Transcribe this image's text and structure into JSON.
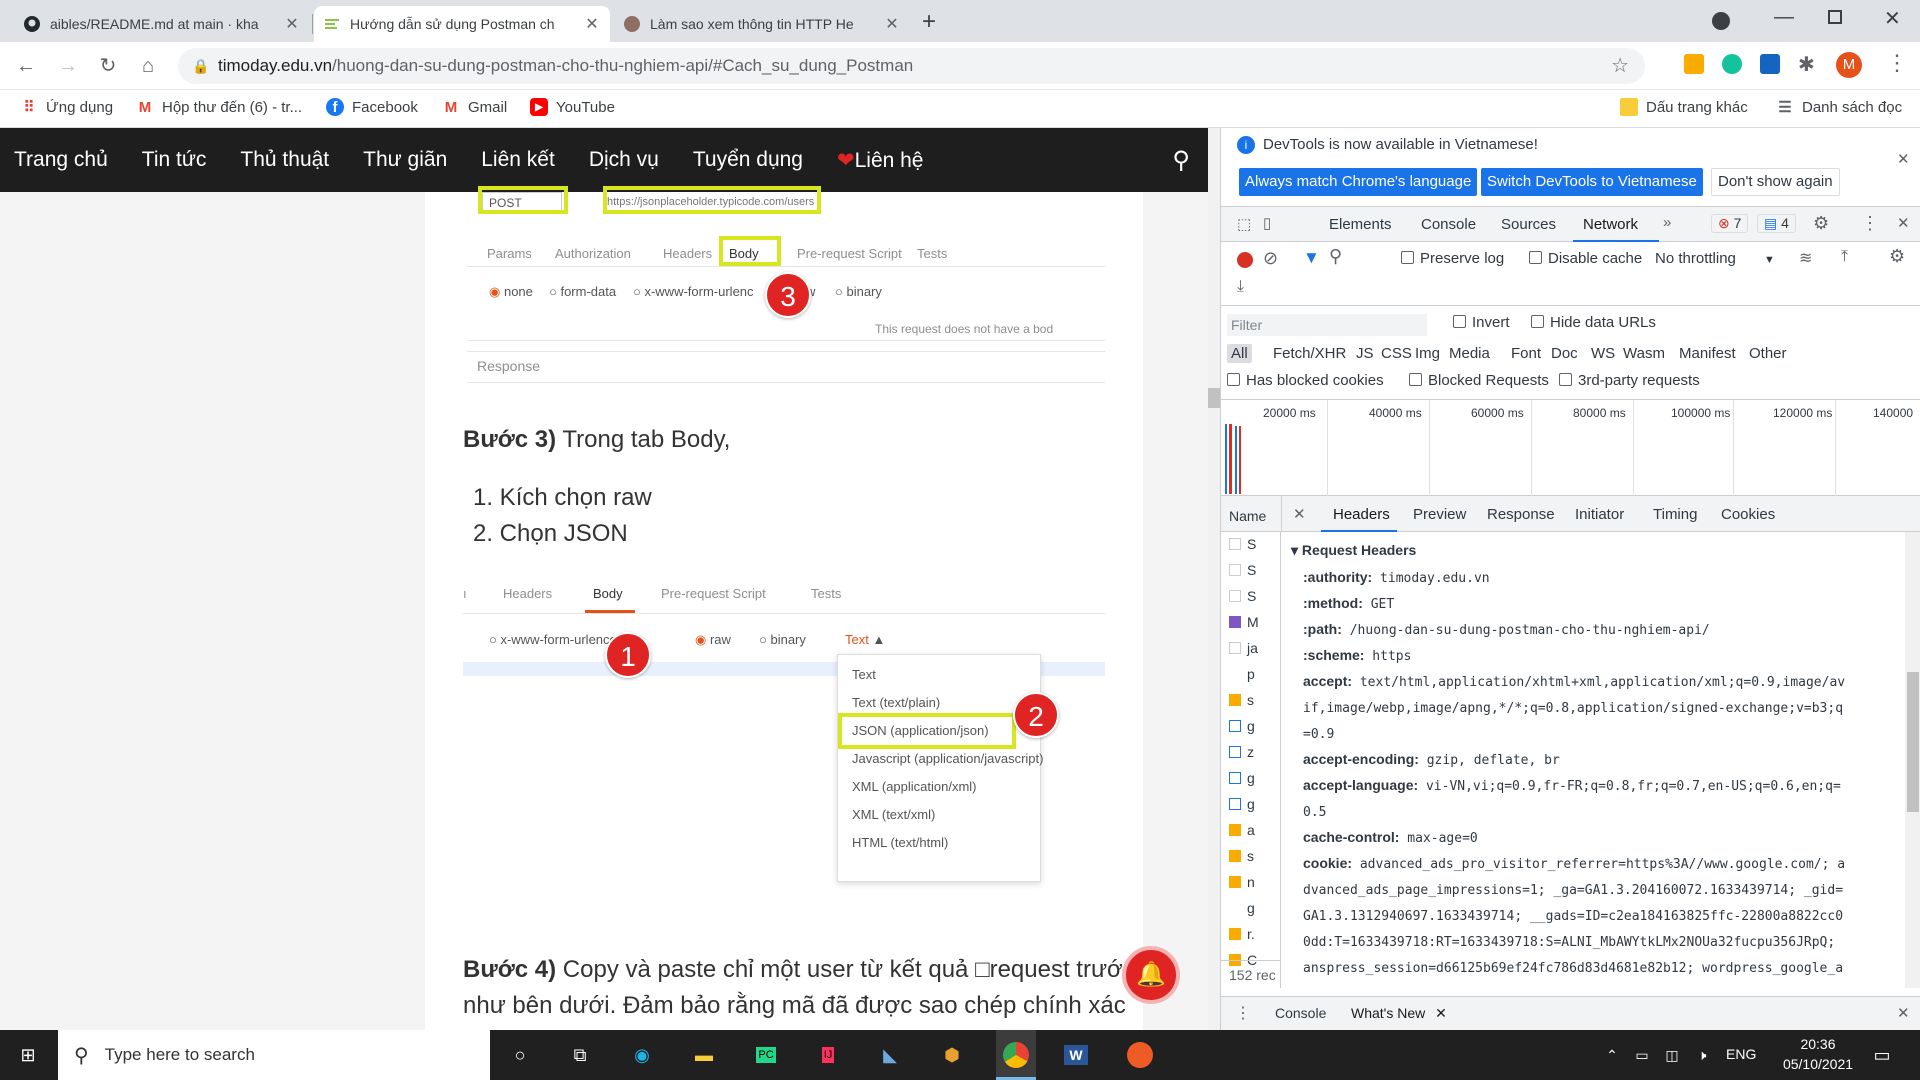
{
  "tabs": [
    {
      "title": "aibles/README.md at main · kha",
      "icon": "github-icon"
    },
    {
      "title": "Hướng dẫn sử dụng Postman ch",
      "icon": "timoday-icon"
    },
    {
      "title": "Làm sao xem thông tin HTTP He",
      "icon": "avatar-icon"
    }
  ],
  "omnibox": {
    "domain": "timoday.edu.vn",
    "path": "/huong-dan-su-dung-postman-cho-thu-nghiem-api/#Cach_su_dung_Postman"
  },
  "profile_initial": "M",
  "bookmarks": [
    {
      "label": "Ứng dụng"
    },
    {
      "label": "Hộp thư đến (6) - tr..."
    },
    {
      "label": "Facebook"
    },
    {
      "label": "Gmail"
    },
    {
      "label": "YouTube"
    }
  ],
  "bookmarks_right": {
    "other": "Dấu trang khác",
    "reading": "Danh sách đọc"
  },
  "site_nav": [
    "Trang chủ",
    "Tin tức",
    "Thủ thuật",
    "Thư giãn",
    "Liên kết",
    "Dịch vụ",
    "Tuyển dụng",
    "Liên hệ"
  ],
  "article": {
    "shot1": {
      "method": "POST",
      "url": "https://jsonplaceholder.typicode.com/users",
      "tabs": [
        "Params",
        "Authorization",
        "Headers",
        "Body",
        "Pre-request Script",
        "Tests"
      ],
      "radios": [
        "none",
        "form-data",
        "x-www-form-urlencoded",
        "raw",
        "binary"
      ],
      "note": "This request does not have a bod",
      "response": "Response",
      "badge": "3"
    },
    "step3_label": "Bước 3)",
    "step3_text": " Trong tab Body,",
    "list": [
      "1. Kích chọn raw",
      "2. Chọn JSON"
    ],
    "shot2": {
      "tabs": [
        "Headers",
        "Body",
        "Pre-request Script",
        "Tests"
      ],
      "radios": [
        "x-www-form-urlencoded",
        "raw",
        "binary"
      ],
      "type": "Text",
      "dropdown": [
        "Text",
        "Text (text/plain)",
        "JSON (application/json)",
        "Javascript (application/javascript)",
        "XML (application/xml)",
        "XML (text/xml)",
        "HTML (text/html)"
      ],
      "badge1": "1",
      "badge2": "2"
    },
    "step4_label": "Bước 4)",
    "step4_text": " Copy và paste chỉ một user từ kết quả □request trước",
    "step4_text2": "như bên dưới. Đảm bảo rằng mã đã được sao chép chính xác"
  },
  "devtools": {
    "info": "DevTools is now available in Vietnamese!",
    "btn_match": "Always match Chrome's language",
    "btn_switch": "Switch DevTools to Vietnamese",
    "btn_dont": "Don't show again",
    "panels": [
      "Elements",
      "Console",
      "Sources",
      "Network"
    ],
    "errors": "7",
    "messages": "4",
    "preserve_log": "Preserve log",
    "disable_cache": "Disable cache",
    "throttling": "No throttling",
    "filter_placeholder": "Filter",
    "invert": "Invert",
    "hide_data_urls": "Hide data URLs",
    "types": [
      "All",
      "Fetch/XHR",
      "JS",
      "CSS",
      "Img",
      "Media",
      "Font",
      "Doc",
      "WS",
      "Wasm",
      "Manifest",
      "Other"
    ],
    "has_blocked_cookies": "Has blocked cookies",
    "blocked_requests": "Blocked Requests",
    "third_party": "3rd-party requests",
    "timeline": [
      "20000 ms",
      "40000 ms",
      "60000 ms",
      "80000 ms",
      "100000 ms",
      "120000 ms",
      "140000"
    ],
    "name_col": "Name",
    "detail_tabs": [
      "Headers",
      "Preview",
      "Response",
      "Initiator",
      "Timing",
      "Cookies"
    ],
    "names": [
      "S",
      "S",
      "S",
      "M",
      "ja",
      "p",
      "s",
      "g",
      "z",
      "g",
      "g",
      "a",
      "s",
      "n",
      "g",
      "r.",
      "C"
    ],
    "requests_count": "152 rec",
    "section": "Request Headers",
    "headers": [
      {
        "k": ":authority:",
        "v": " timoday.edu.vn"
      },
      {
        "k": ":method:",
        "v": " GET"
      },
      {
        "k": ":path:",
        "v": " /huong-dan-su-dung-postman-cho-thu-nghiem-api/"
      },
      {
        "k": ":scheme:",
        "v": " https"
      },
      {
        "k": "accept:",
        "v": " text/html,application/xhtml+xml,application/xml;q=0.9,image/av"
      },
      {
        "k": "",
        "v": "if,image/webp,image/apng,*/*;q=0.8,application/signed-exchange;v=b3;q"
      },
      {
        "k": "",
        "v": "=0.9"
      },
      {
        "k": "accept-encoding:",
        "v": " gzip, deflate, br"
      },
      {
        "k": "accept-language:",
        "v": " vi-VN,vi;q=0.9,fr-FR;q=0.8,fr;q=0.7,en-US;q=0.6,en;q="
      },
      {
        "k": "",
        "v": "0.5"
      },
      {
        "k": "cache-control:",
        "v": " max-age=0"
      },
      {
        "k": "cookie:",
        "v": " advanced_ads_pro_visitor_referrer=https%3A//www.google.com/; a"
      },
      {
        "k": "",
        "v": "dvanced_ads_page_impressions=1; _ga=GA1.3.204160072.1633439714; _gid="
      },
      {
        "k": "",
        "v": "GA1.3.1312940697.1633439714; __gads=ID=c2ea184163825ffc-22800a8822cc0"
      },
      {
        "k": "",
        "v": "0dd:T=1633439718:RT=1633439718:S=ALNI_MbAWYtkLMx2NOUa32fucpu356JRpQ;"
      },
      {
        "k": "",
        "v": "anspress_session=d66125b69ef24fc786d83d4681e82b12; wordpress_google_a"
      }
    ],
    "drawer_console": "Console",
    "drawer_whatsnew": "What's New"
  },
  "taskbar": {
    "search": "Type here to search",
    "lang": "ENG",
    "time": "20:36",
    "date": "05/10/2021"
  }
}
